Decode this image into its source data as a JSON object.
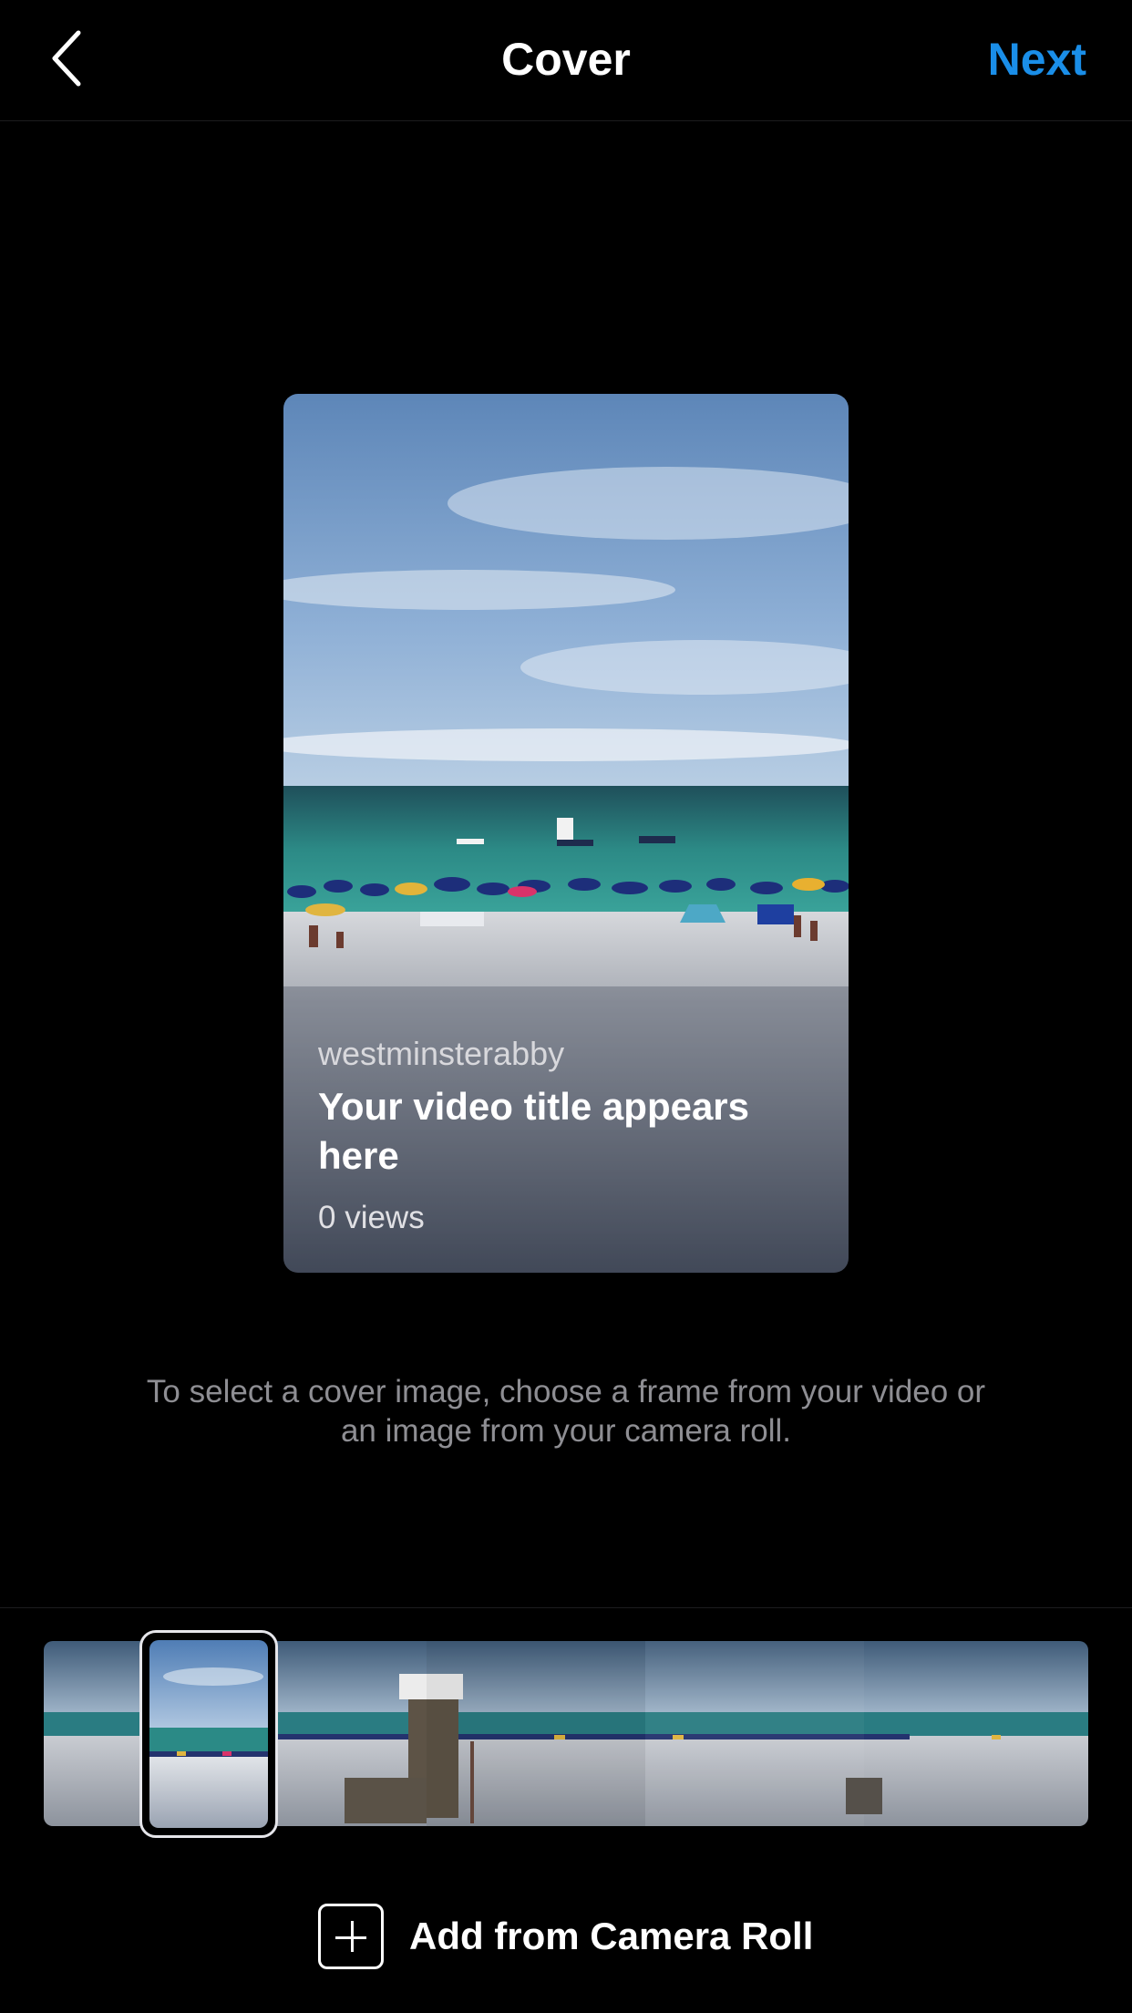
{
  "header": {
    "title": "Cover",
    "next_label": "Next",
    "back_icon": "chevron-left-icon"
  },
  "preview": {
    "username": "westminsterabby",
    "video_title": "Your video title appears here",
    "views": "0 views"
  },
  "hint": "To select a cover image, choose a frame from your video or an image from your camera roll.",
  "add_from_camera_roll": {
    "label": "Add from Camera Roll",
    "icon": "plus-square-icon"
  },
  "colors": {
    "accent": "#1a8ee8",
    "background": "#000000",
    "hint_text": "#8e8e93"
  }
}
